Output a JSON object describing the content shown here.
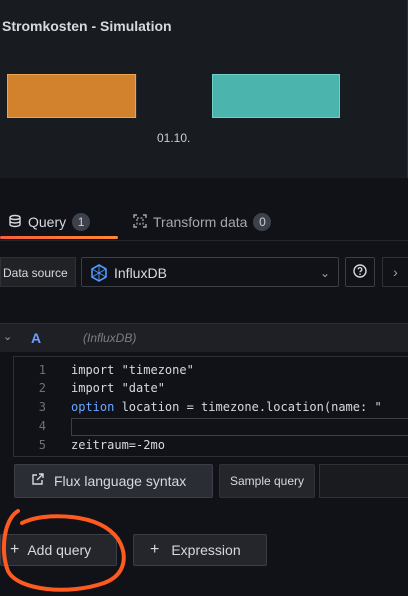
{
  "panel": {
    "title": "Stromkosten - Simulation",
    "x_tick": "01.10.",
    "colors": {
      "bar_1": "#d2812c",
      "bar_2": "#4bb5ad"
    }
  },
  "tabs": [
    {
      "label": "Query",
      "count": "1",
      "icon": "database-icon",
      "active": true
    },
    {
      "label": "Transform data",
      "count": "0",
      "icon": "transform-icon",
      "active": false
    }
  ],
  "datasource": {
    "label": "Data source",
    "selected": "InfluxDB",
    "icon": "influxdb-logo"
  },
  "query": {
    "ref_id": "A",
    "datasource_name": "(InfluxDB)",
    "lines": [
      {
        "num": "1",
        "text": "import \"timezone\""
      },
      {
        "num": "2",
        "text": "import \"date\""
      },
      {
        "num": "3",
        "keyword": "option",
        "text": " location = timezone.location(name: \""
      },
      {
        "num": "4",
        "text": ""
      },
      {
        "num": "5",
        "text": "zeitraum=-2mo"
      }
    ]
  },
  "toolbar": {
    "flux_syntax": "Flux language syntax",
    "sample_query": "Sample query"
  },
  "actions": {
    "add_query": "Add query",
    "expression": "Expression"
  },
  "colors": {
    "accent_underline": "#f55f3e",
    "annotation": "#ff5a1f",
    "ref_id": "#6e9fff"
  }
}
